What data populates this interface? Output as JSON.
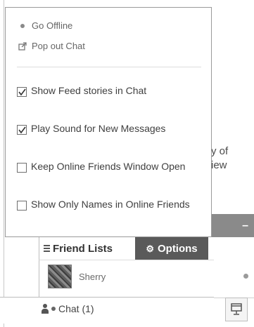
{
  "menu": {
    "go_offline": "Go Offline",
    "pop_out_chat": "Pop out Chat",
    "options": [
      {
        "label": "Show Feed stories in Chat",
        "checked": true
      },
      {
        "label": "Play Sound for New Messages",
        "checked": true
      },
      {
        "label": "Keep Online Friends Window Open",
        "checked": false
      },
      {
        "label": "Show Only Names in Online Friends",
        "checked": false
      }
    ]
  },
  "background_text": {
    "line1": "y of",
    "line2": "iew"
  },
  "tabs": {
    "friend_lists": "Friend Lists",
    "options": "Options"
  },
  "friends": [
    {
      "name": "Sherry",
      "status": "online"
    }
  ],
  "chat_bar": {
    "label": "Chat (1)"
  },
  "colors": {
    "options_tab_bg": "#5a5a5a",
    "strip_bg": "#8a8a8a"
  },
  "icons": {
    "go_offline": "bullet-icon",
    "pop_out": "popout-icon",
    "friend_lists": "list-icon",
    "options": "gear-icon",
    "chat": "person-icon",
    "window": "window-icon"
  }
}
